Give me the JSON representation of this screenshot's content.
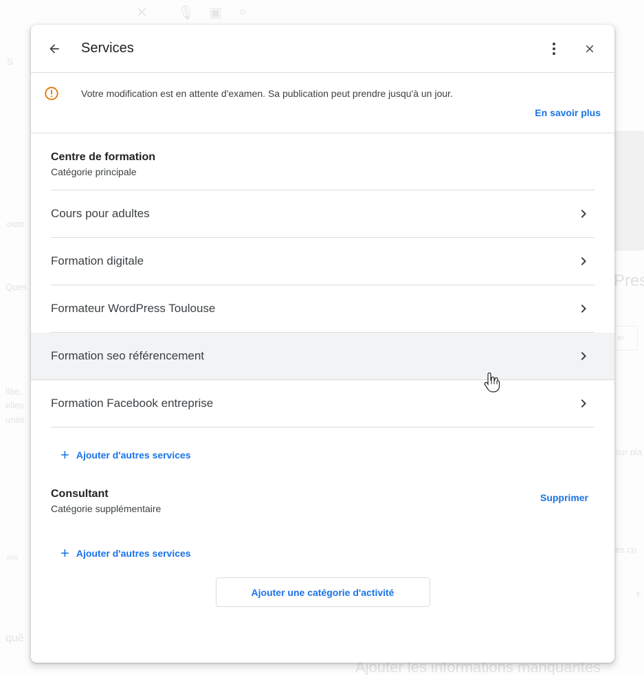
{
  "background": {
    "left_labels": [
      "S",
      "oute",
      "Ques",
      "llée,",
      "elles",
      "unité",
      "ons",
      "quê"
    ],
    "right_labels": [
      "Pres",
      "er",
      "sur pla",
      "es co",
      "F"
    ],
    "bottom_text": "Ajouter les informations manquantes"
  },
  "dialog": {
    "title": "Services",
    "notice": {
      "text": "Votre modification est en attente d'examen. Sa publication peut prendre jusqu'à un jour.",
      "learn_more": "En savoir plus"
    },
    "primary_category": {
      "name": "Centre de formation",
      "type": "Catégorie principale",
      "services": [
        {
          "label": "Cours pour adultes"
        },
        {
          "label": "Formation digitale"
        },
        {
          "label": "Formateur WordPress Toulouse"
        },
        {
          "label": "Formation seo référencement"
        },
        {
          "label": "Formation Facebook entreprise"
        }
      ],
      "add_services_label": "Ajouter d'autres services"
    },
    "additional_category": {
      "name": "Consultant",
      "type": "Catégorie supplémentaire",
      "delete_label": "Supprimer",
      "add_services_label": "Ajouter d'autres services"
    },
    "add_category_label": "Ajouter une catégorie d'activité"
  },
  "colors": {
    "accent": "#1a73e8",
    "warning": "#e37400",
    "divider": "#dadce0",
    "hover_row": "#f1f3f4"
  },
  "icons": [
    "arrow-back-icon",
    "more-vert-icon",
    "close-icon",
    "warning-circle-icon",
    "chevron-right-icon",
    "plus-icon",
    "hand-pointer-icon"
  ]
}
